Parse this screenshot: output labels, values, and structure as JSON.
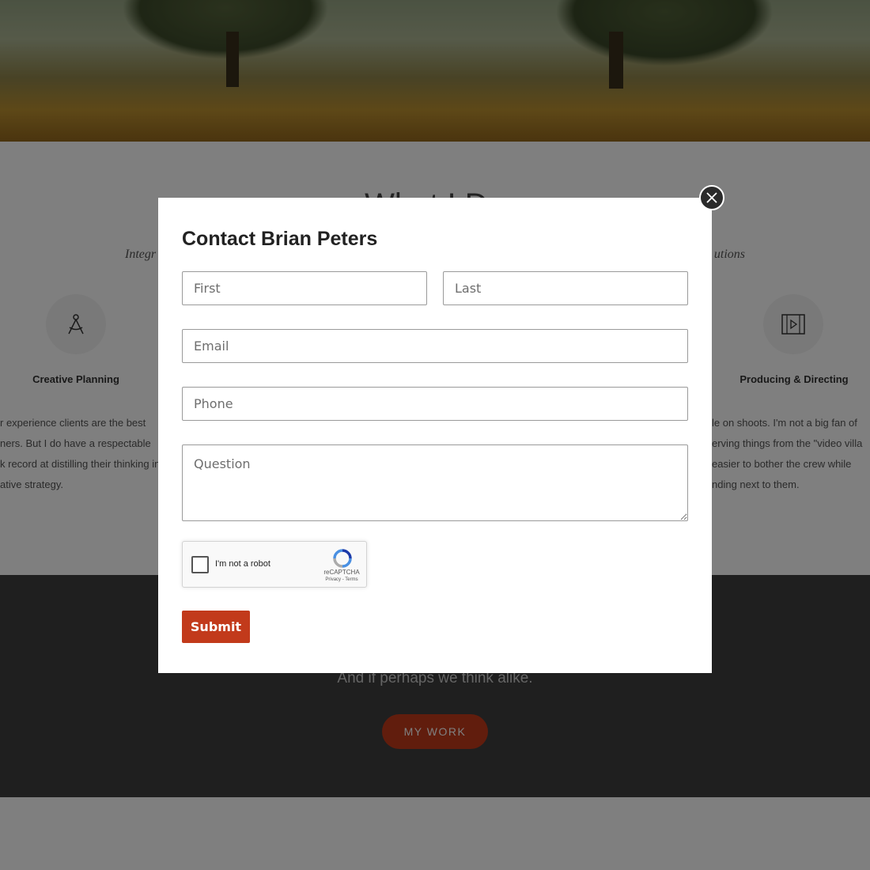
{
  "page": {
    "section_title": "What I Do",
    "section_subtitle_left": "Integr",
    "section_subtitle_right": "utions",
    "services": [
      {
        "name": "Creative Planning",
        "icon": "compass-icon",
        "text": [
          "r experience clients are the best",
          "ners. But I do have a respectable",
          "k record at distilling their thinking in",
          "ative strategy."
        ]
      },
      {
        "name": "Producing & Directing",
        "icon": "film-icon",
        "text": [
          "le on shoots. I'm not a big fan of",
          "erving things from the \"video villa",
          "easier to bother the crew while",
          "nding next to them."
        ]
      }
    ],
    "cta_line": "And if perhaps we think alike.",
    "cta_button": "MY WORK"
  },
  "modal": {
    "title": "Contact Brian Peters",
    "fields": {
      "first_placeholder": "First",
      "last_placeholder": "Last",
      "email_placeholder": "Email",
      "phone_placeholder": "Phone",
      "question_placeholder": "Question"
    },
    "recaptcha": {
      "label": "I'm not a robot",
      "brand": "reCAPTCHA",
      "links": "Privacy - Terms"
    },
    "submit_label": "Submit",
    "close_icon": "close-icon"
  },
  "colors": {
    "accent": "#c23a1b",
    "overlay": "rgba(0,0,0,0.5)",
    "modal_bg": "#ffffff"
  }
}
